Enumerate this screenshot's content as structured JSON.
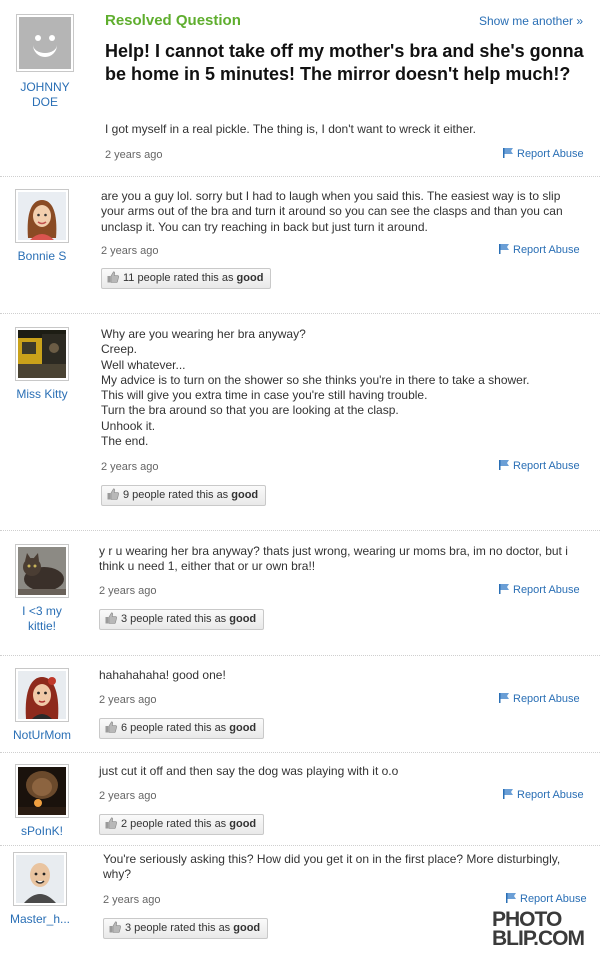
{
  "question": {
    "status": "Resolved Question",
    "show_another": "Show me another »",
    "asker": "JOHNNY DOE",
    "title": "Help! I cannot take off my mother's bra and she's gonna be home in 5 minutes! The mirror doesn't help much!?",
    "body": "I got myself in a real pickle. The thing is, I don't want to wreck it either.",
    "time": "2 years ago",
    "report": "Report Abuse"
  },
  "answers": [
    {
      "user": "Bonnie S",
      "text": "are you a guy lol. sorry but I had to laugh when you said this. The easiest way is to slip your arms out of the bra and turn it around so you can see the clasps and than you can unclasp it. You can try reaching in back but just turn it around.",
      "time": "2 years ago",
      "report": "Report Abuse",
      "rating_prefix": "11 people rated this as",
      "rating_word": "good"
    },
    {
      "user": "Miss Kitty",
      "text": "Why are you wearing her bra anyway?\nCreep.\nWell whatever...\nMy advice is to turn on the shower so she thinks you're in there to take a shower.\nThis will give you extra time in case you're still having trouble.\nTurn the bra around so that you are looking at the clasp.\nUnhook it.\nThe end.",
      "time": "2 years ago",
      "report": "Report Abuse",
      "rating_prefix": "9 people rated this as",
      "rating_word": "good"
    },
    {
      "user": "I <3 my kittie!",
      "text": "y r u wearing her bra anyway? thats just wrong, wearing ur moms bra, im no doctor, but i think u need 1, either that or ur own bra!!",
      "time": "2 years ago",
      "report": "Report Abuse",
      "rating_prefix": "3 people rated this as",
      "rating_word": "good"
    },
    {
      "user": "NotUrMom",
      "text": "hahahahaha! good one!",
      "time": "2 years ago",
      "report": "Report Abuse",
      "rating_prefix": "6 people rated this as",
      "rating_word": "good"
    },
    {
      "user": "sPoInK!",
      "text": "just cut it off and then say the dog was playing with it o.o",
      "time": "2 years ago",
      "report": "Report Abuse",
      "rating_prefix": "2 people rated this as",
      "rating_word": "good"
    },
    {
      "user": "Master_h...",
      "text": "You're seriously asking this? How did you get it on in the first place? More disturbingly, why?",
      "time": "2 years ago",
      "report": "Report Abuse",
      "rating_prefix": "3 people rated this as",
      "rating_word": "good"
    }
  ],
  "watermark": {
    "line1": "PHOTO",
    "line2": "BLIP.COM"
  },
  "colors": {
    "link": "#2a6fb5",
    "resolved": "#5fae2e"
  }
}
